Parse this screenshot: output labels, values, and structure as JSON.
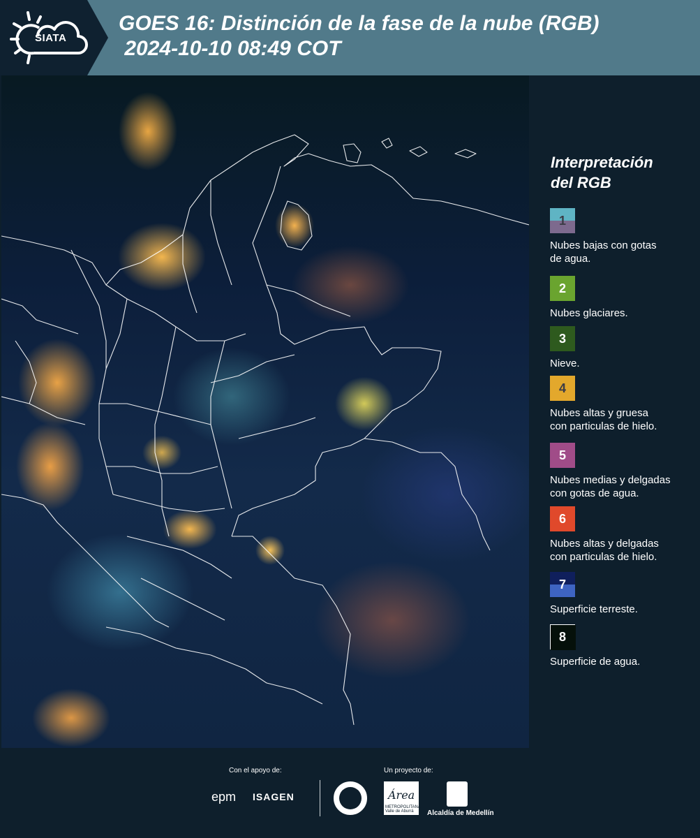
{
  "header": {
    "logo_text": "SIATA",
    "title": "GOES 16: Distinción de la fase de la nube (RGB)\n 2024-10-10 08:49 COT"
  },
  "legend": {
    "title": "Interpretación\ndel RGB",
    "items": [
      {
        "num": "1",
        "label": "Nubes bajas con gotas\nde agua.",
        "color_top": "#5fb4c4",
        "color_bottom": "#7d6a8e",
        "num_color": "#3c3c46"
      },
      {
        "num": "2",
        "label": "Nubes glaciares.",
        "color_top": "#6aa42f",
        "color_bottom": "#6aa42f",
        "num_color": "#ffffff"
      },
      {
        "num": "3",
        "label": "Nieve.",
        "color_top": "#2e5a1e",
        "color_bottom": "#2e5a1e",
        "num_color": "#ffffff"
      },
      {
        "num": "4",
        "label": "Nubes altas y gruesa\ncon particulas de hielo.",
        "color_top": "#e3a82c",
        "color_bottom": "#e3a82c",
        "num_color": "#3c3c46"
      },
      {
        "num": "5",
        "label": "Nubes medias y delgadas\ncon gotas de agua.",
        "color_top": "#a04c88",
        "color_bottom": "#a04c88",
        "num_color": "#ffffff"
      },
      {
        "num": "6",
        "label": "Nubes altas y delgadas\ncon particulas de hielo.",
        "color_top": "#e0492b",
        "color_bottom": "#e0492b",
        "num_color": "#ffffff"
      },
      {
        "num": "7",
        "label": "Superficie terreste.",
        "color_top": "#0f1f5c",
        "color_bottom": "#3e64c2",
        "num_color": "#ffffff"
      },
      {
        "num": "8",
        "label": "Superficie de agua.",
        "color_top": "#05100a",
        "color_bottom": "#05100a",
        "num_color": "#ffffff"
      }
    ]
  },
  "footer": {
    "support_label": "Con el apoyo de:",
    "project_label": "Un proyecto de:",
    "epm": "epm",
    "isagen": "ISAGEN",
    "area_text": "Área",
    "area_sub": "METROPOLITANA Valle de Aburrá",
    "alcaldia": "Alcaldía de Medellín"
  }
}
